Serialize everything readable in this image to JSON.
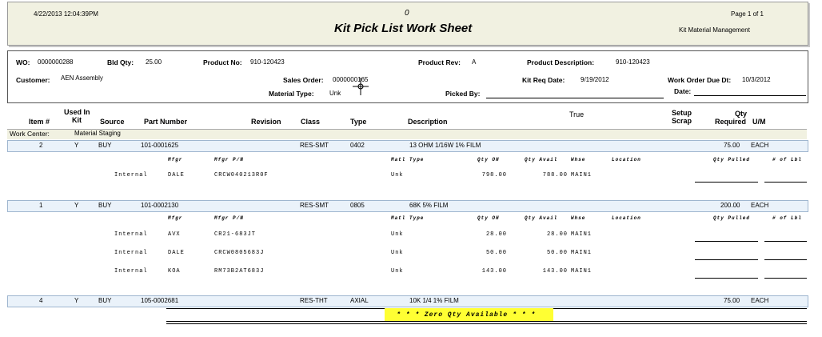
{
  "header": {
    "datetime": "4/22/2013  12:04:39PM",
    "zero": "0",
    "title": "Kit Pick List Work Sheet",
    "page": "Page 1 of 1",
    "module": "Kit Material Management"
  },
  "info": {
    "wo_label": "WO:",
    "wo_value": "0000000288",
    "bldqty_label": "Bld Qty:",
    "bldqty_value": "25.00",
    "productno_label": "Product No:",
    "productno_value": "910-120423",
    "productrev_label": "Product Rev:",
    "productrev_value": "A",
    "productdesc_label": "Product Description:",
    "productdesc_value": "910-120423",
    "customer_label": "Customer:",
    "customer_value": "AEN Assembly",
    "salesorder_label": "Sales Order:",
    "salesorder_value": "0000000165",
    "kitreq_label": "Kit Req Date:",
    "kitreq_value": "9/19/2012",
    "wodue_label": "Work Order Due Dt:",
    "wodue_value": "10/3/2012",
    "materialtype_label": "Material Type:",
    "materialtype_value": "Unk",
    "pickedby_label": "Picked By:",
    "date_label": "Date:"
  },
  "columns": {
    "item": "Item #",
    "usedin": "Used In",
    "kit": "Kit",
    "source": "Source",
    "partnumber": "Part Number",
    "revision": "Revision",
    "class": "Class",
    "type": "Type",
    "description": "Description",
    "true": "True",
    "setup": "Setup",
    "scrap": "Scrap",
    "qty": "Qty",
    "required": "Required",
    "um": "U/M"
  },
  "workcenter": {
    "label": "Work Center:",
    "value": "Material Staging"
  },
  "sub_headers": {
    "mfgr": "Mfgr",
    "mfgrpn": "Mfgr P/N",
    "matltype": "Matl Type",
    "qtyoh": "Qty OH",
    "qtyavail": "Qty Avail",
    "whse": "Whse",
    "location": "Location",
    "qtypulled": "Qty Pulled",
    "oflbl": "# of Lbl"
  },
  "items": [
    {
      "item": "2",
      "kit": "Y",
      "source": "BUY",
      "part": "101-0001625",
      "class": "RES-SMT",
      "type": "0402",
      "desc": "13 OHM 1/16W 1% FILM",
      "qty": "75.00",
      "um": "EACH",
      "subs": [
        {
          "src": "Internal",
          "mfgr": "DALE",
          "pn": "CRCW040213R0F",
          "matl": "Unk",
          "oh": "798.00",
          "avail": "788.00",
          "whse": "MAIN1"
        }
      ]
    },
    {
      "item": "1",
      "kit": "Y",
      "source": "BUY",
      "part": "101-0002130",
      "class": "RES-SMT",
      "type": "0805",
      "desc": "68K 5% FILM",
      "qty": "200.00",
      "um": "EACH",
      "subs": [
        {
          "src": "Internal",
          "mfgr": "AVX",
          "pn": "CR21-683JT",
          "matl": "Unk",
          "oh": "28.00",
          "avail": "28.00",
          "whse": "MAIN1"
        },
        {
          "src": "Internal",
          "mfgr": "DALE",
          "pn": "CRCW0805683J",
          "matl": "Unk",
          "oh": "50.00",
          "avail": "50.00",
          "whse": "MAIN1"
        },
        {
          "src": "Internal",
          "mfgr": "KOA",
          "pn": "RM73B2AT683J",
          "matl": "Unk",
          "oh": "143.00",
          "avail": "143.00",
          "whse": "MAIN1"
        }
      ]
    },
    {
      "item": "4",
      "kit": "Y",
      "source": "BUY",
      "part": "105-0002681",
      "class": "RES-THT",
      "type": "AXIAL",
      "desc": "10K 1/4 1% FILM",
      "qty": "75.00",
      "um": "EACH",
      "subs": []
    }
  ],
  "zero_qty_text": "* * *  Zero Qty Available  * * *",
  "colors": {
    "header_bg": "#f1f1e1",
    "band_bg": "#eaf2fa",
    "highlight": "#ffff33"
  }
}
